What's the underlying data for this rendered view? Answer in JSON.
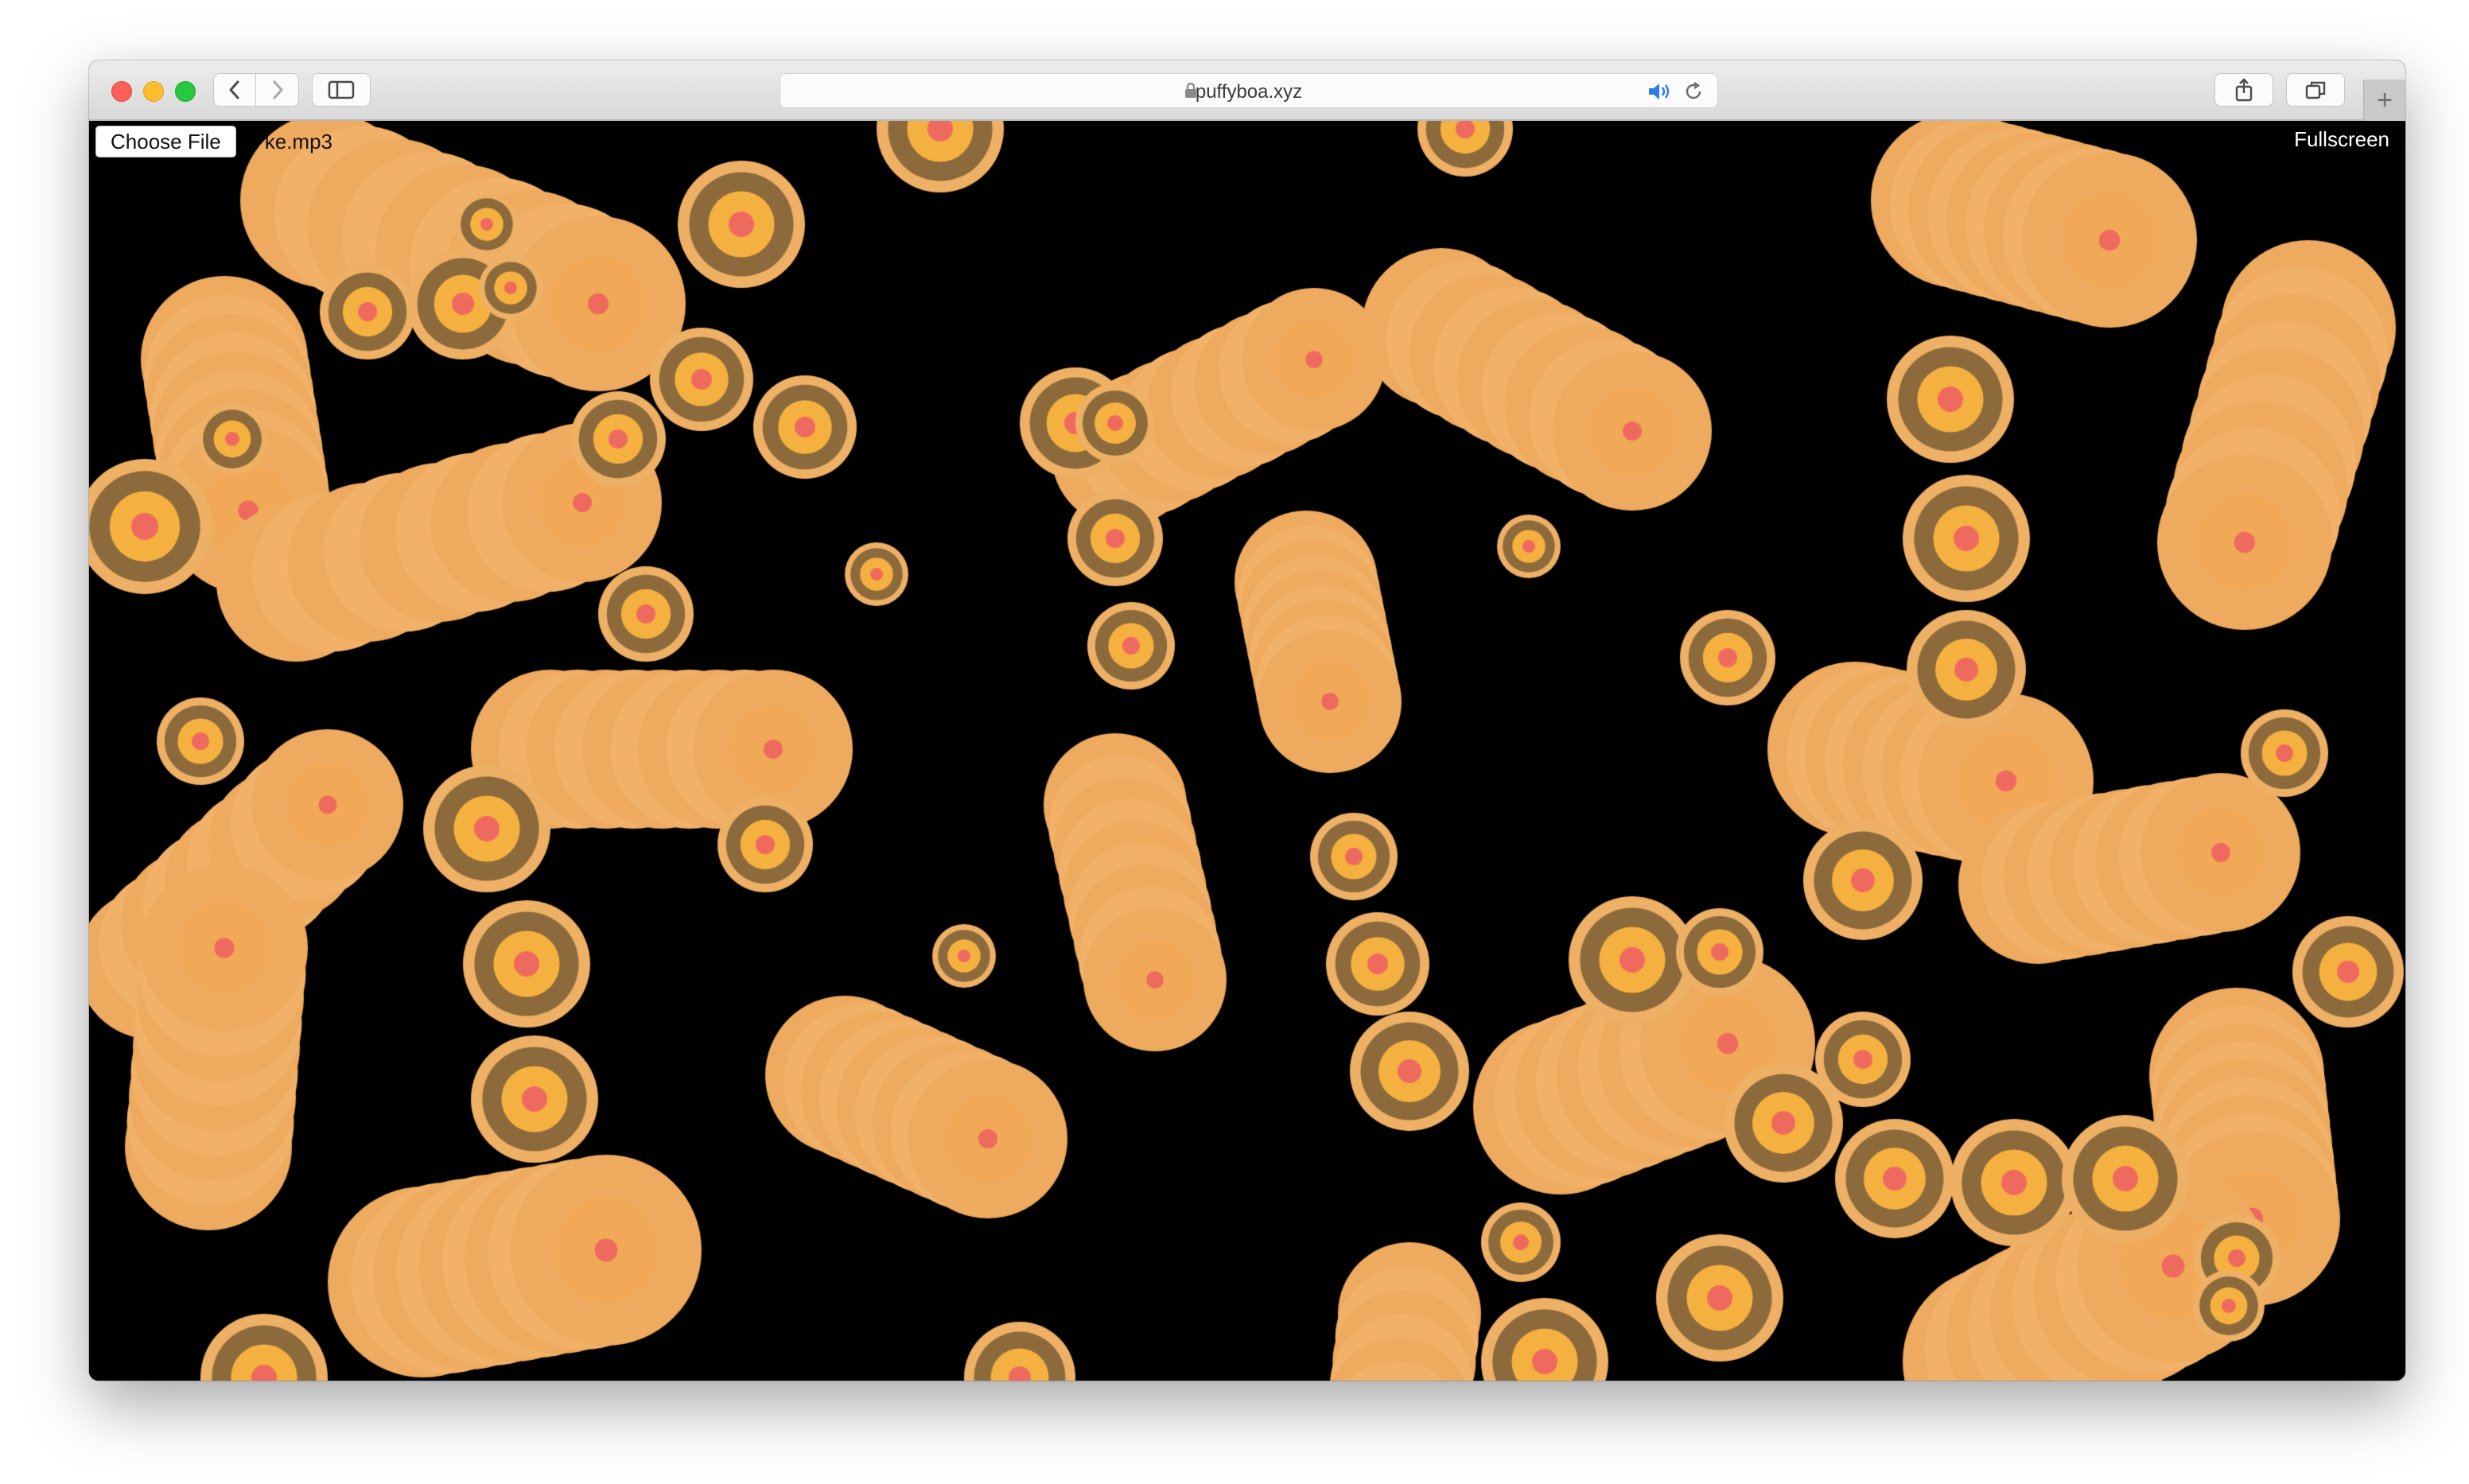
{
  "browser": {
    "url": "puffyboa.xyz",
    "new_tab_label": "+"
  },
  "page": {
    "choose_file_label": "Choose File",
    "file_name": "ke.mp3",
    "fullscreen_label": "Fullscreen"
  },
  "colors": {
    "background": "#000000",
    "outer": "#eeb064",
    "ring": "#8c6a3c",
    "inner": "#f5b140",
    "center": "#ef6a5e"
  },
  "icons": [
    "back-icon",
    "forward-icon",
    "sidebar-icon",
    "lock-icon",
    "speaker-icon",
    "reload-icon",
    "share-icon",
    "tabs-icon"
  ]
}
